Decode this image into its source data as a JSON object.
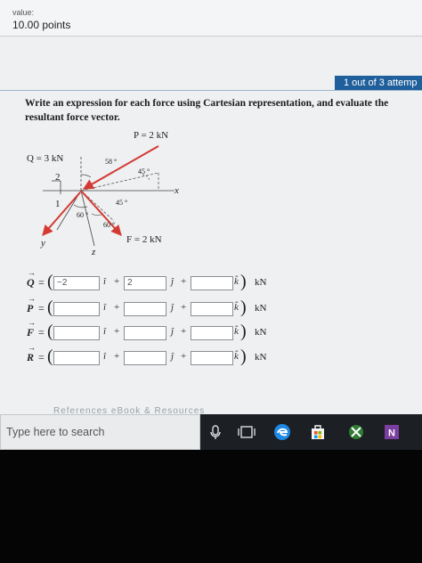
{
  "header": {
    "value_label": "value:",
    "points": "10.00 points"
  },
  "attempt_badge": "1 out of 3 attemp",
  "question": "Write an expression for each force using Cartesian representation, and evaluate the resultant force vector.",
  "figure": {
    "label_P": "P = 2 kN",
    "label_Q": "Q = 3 kN",
    "label_F": "F = 2 kN",
    "angle_58": "58 °",
    "angle_45a": "45 °",
    "angle_45b": "45 °",
    "angle_60a": "60 °",
    "angle_60b": "60 °",
    "ratio_2": "2",
    "ratio_1": "1",
    "axis_x": "x",
    "axis_y": "y",
    "axis_z": "z",
    "colors": {
      "force": "#d43a33",
      "axis": "#444444"
    }
  },
  "equations": [
    {
      "symbol": "Q",
      "i": "−2",
      "j": "2",
      "k": "",
      "unit": "kN"
    },
    {
      "symbol": "P",
      "i": "",
      "j": "",
      "k": "",
      "unit": "kN"
    },
    {
      "symbol": "F",
      "i": "",
      "j": "",
      "k": "",
      "unit": "kN"
    },
    {
      "symbol": "R",
      "i": "",
      "j": "",
      "k": "",
      "unit": "kN"
    }
  ],
  "units": {
    "i": "î",
    "j": "ĵ",
    "k": "k̂",
    "eq": "=",
    "plus": "+",
    "lp": "(",
    "rp": ")"
  },
  "references": "References    eBook & Resources",
  "taskbar": {
    "search_placeholder": "Type here to search",
    "icons": [
      "microphone-icon",
      "task-view-icon",
      "edge-icon",
      "store-icon",
      "xbox-icon",
      "onenote-icon"
    ]
  }
}
